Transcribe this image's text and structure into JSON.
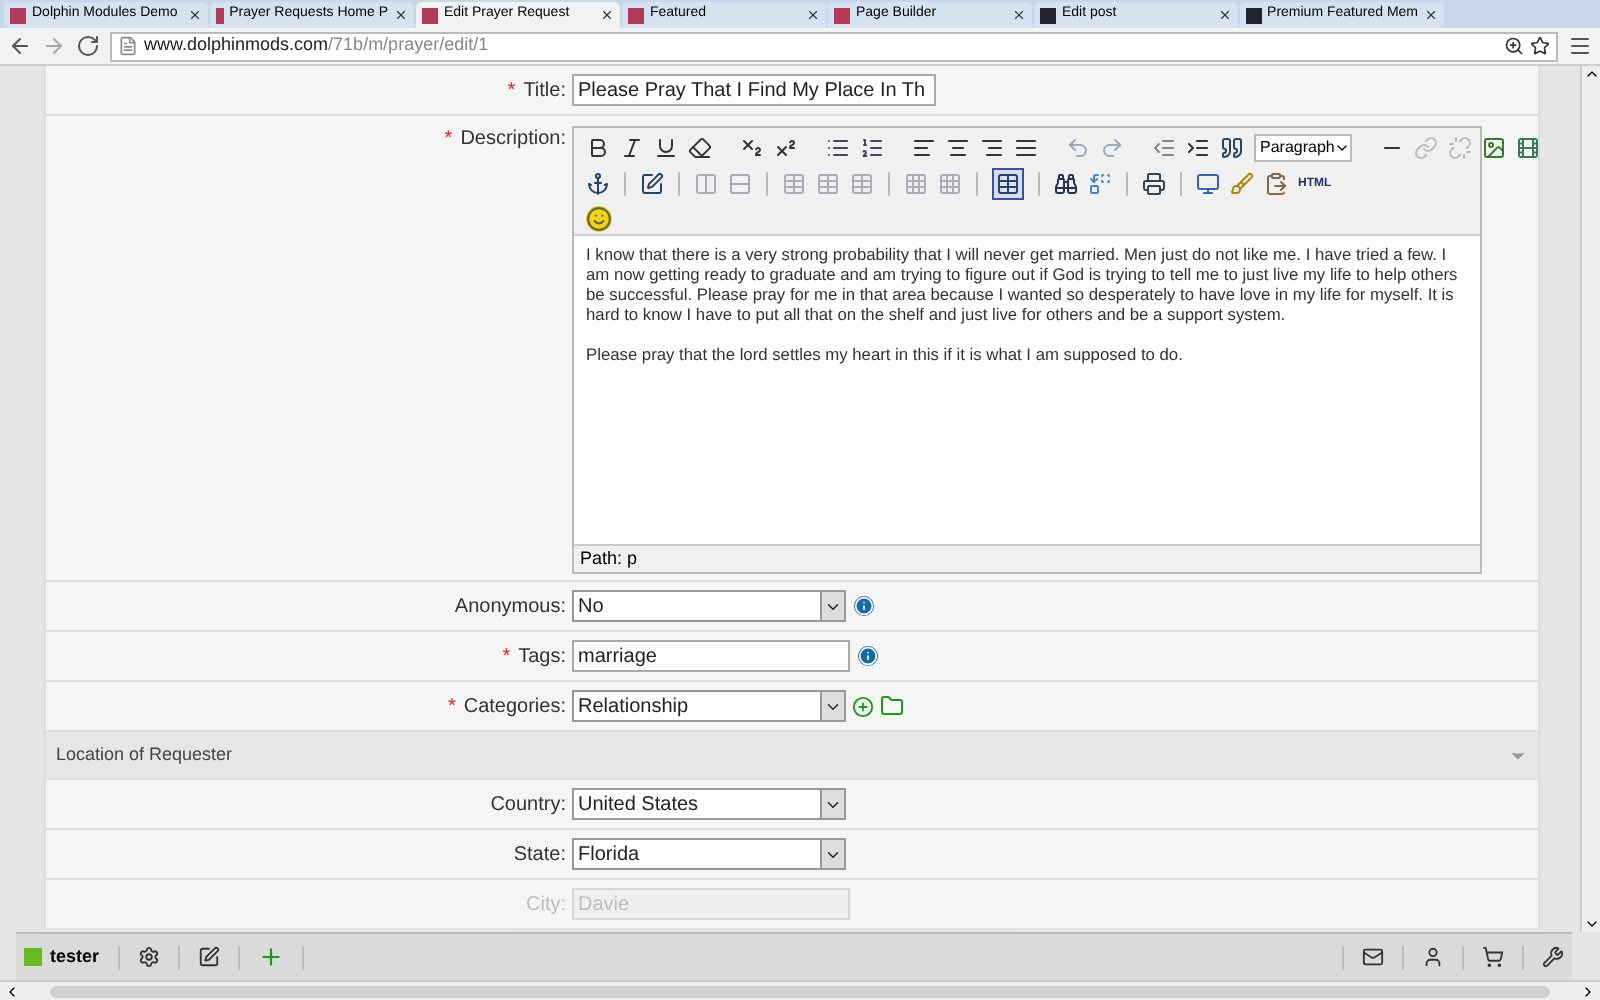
{
  "tabs": [
    {
      "label": "Dolphin Modules Demo",
      "selected": false,
      "kind": "site"
    },
    {
      "label": "Prayer Requests Home P",
      "selected": false,
      "kind": "site"
    },
    {
      "label": "Edit Prayer Request",
      "selected": true,
      "kind": "site"
    },
    {
      "label": "Featured",
      "selected": false,
      "kind": "site"
    },
    {
      "label": "Page Builder",
      "selected": false,
      "kind": "site"
    },
    {
      "label": "Edit post",
      "selected": false,
      "kind": "dark"
    },
    {
      "label": "Premium Featured Mem",
      "selected": false,
      "kind": "dark"
    }
  ],
  "address": {
    "domain": "www.dolphinmods.com",
    "path": "/71b/m/prayer/edit/1"
  },
  "required_mark": "*",
  "fields": [
    {
      "kind": "text",
      "label": "Title:",
      "required": true,
      "value": "Please Pray That I Find My Place In Th"
    },
    {
      "kind": "editor",
      "label": "Description:",
      "required": true,
      "format": "Paragraph",
      "html_button": "HTML",
      "paragraphs": [
        "I know that there is a very strong probability that I will never get married. Men just do not like me. I have tried a few. I am now getting ready to graduate and am trying to figure out if God is trying to tell me to just live my life to help others be successful. Please pray for me in that area because I wanted so desperately to have love in my life for myself. It is hard to know I have to put all that on the shelf and just live for others and be a support system.",
        "Please pray that the lord settles my heart in this if it is what I am supposed to do."
      ],
      "path": "Path: p"
    },
    {
      "kind": "select",
      "label": "Anonymous:",
      "required": false,
      "value": "No",
      "info": true
    },
    {
      "kind": "text",
      "label": "Tags:",
      "required": true,
      "value": "marriage",
      "info": true
    },
    {
      "kind": "category",
      "label": "Categories:",
      "required": true,
      "value": "Relationship"
    }
  ],
  "section": {
    "title": "Location of Requester",
    "expanded": true
  },
  "location_fields": [
    {
      "kind": "select",
      "label": "Country:",
      "value": "United States",
      "disabled": false
    },
    {
      "kind": "select",
      "label": "State:",
      "value": "Florida",
      "disabled": false
    },
    {
      "kind": "text",
      "label": "City:",
      "value": "Davie",
      "disabled": true
    }
  ],
  "bottom_bar": {
    "user": "tester",
    "color": "#66bb22"
  }
}
